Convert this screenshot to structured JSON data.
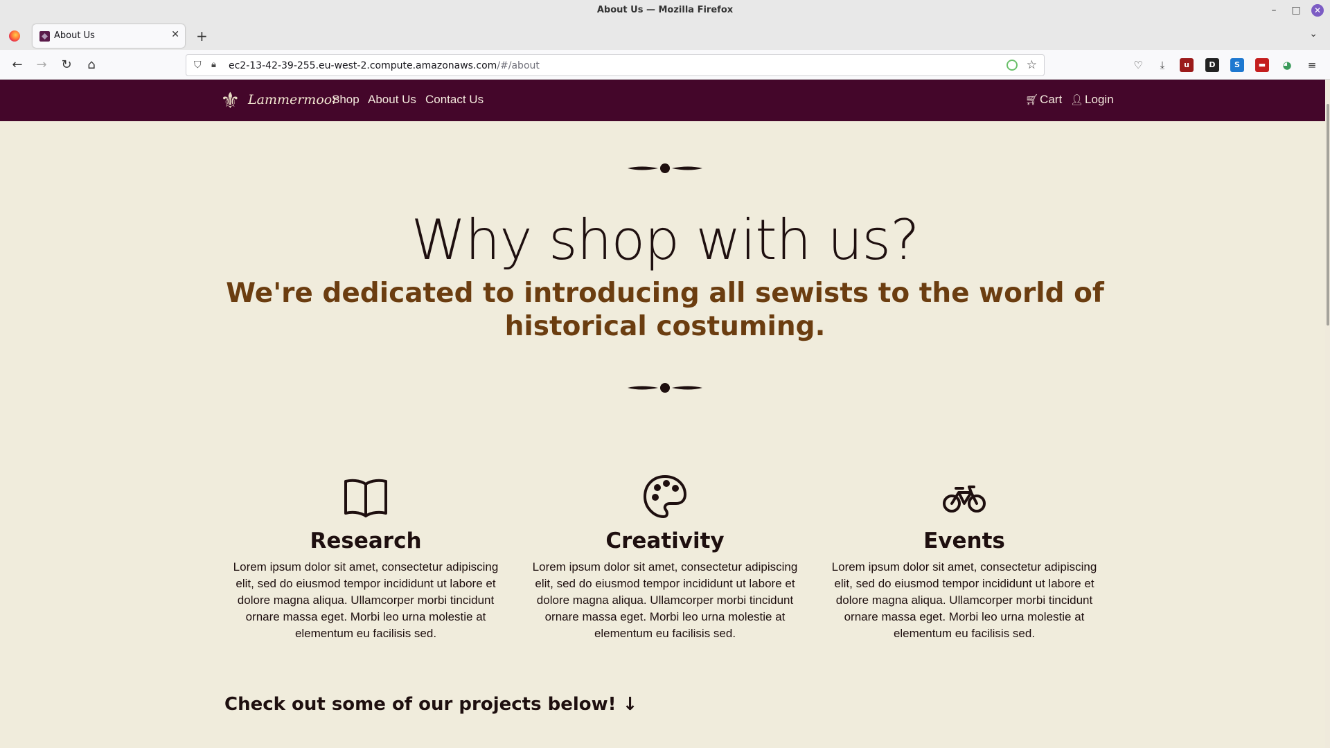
{
  "window": {
    "title": "About Us — Mozilla Firefox"
  },
  "tabs": [
    {
      "label": "About Us",
      "active": true
    }
  ],
  "address_bar": {
    "url_host": "ec2-13-42-39-255.eu-west-2.compute.amazonaws.com",
    "url_path": "/#/about"
  },
  "site_nav": {
    "brand": "Lammermoor",
    "links": [
      "Shop",
      "About Us",
      "Contact Us"
    ],
    "cart_label": "Cart",
    "login_label": "Login",
    "background_color": "#44062a"
  },
  "hero": {
    "title": "Why shop with us?",
    "subtitle": "We're dedicated to introducing all sewists to the world of historical costuming."
  },
  "features": [
    {
      "icon": "book-icon",
      "title": "Research",
      "text": "Lorem ipsum dolor sit amet, consectetur adipiscing elit, sed do eiusmod tempor incididunt ut labore et dolore magna aliqua. Ullamcorper morbi tincidunt ornare massa eget. Morbi leo urna molestie at elementum eu facilisis sed."
    },
    {
      "icon": "palette-icon",
      "title": "Creativity",
      "text": "Lorem ipsum dolor sit amet, consectetur adipiscing elit, sed do eiusmod tempor incididunt ut labore et dolore magna aliqua. Ullamcorper morbi tincidunt ornare massa eget. Morbi leo urna molestie at elementum eu facilisis sed."
    },
    {
      "icon": "bicycle-icon",
      "title": "Events",
      "text": "Lorem ipsum dolor sit amet, consectetur adipiscing elit, sed do eiusmod tempor incididunt ut labore et dolore magna aliqua. Ullamcorper morbi tincidunt ornare massa eget. Morbi leo urna molestie at elementum eu facilisis sed."
    }
  ],
  "projects_cta": "Check out some of our projects below! ↓",
  "colors": {
    "page_background": "#f0ecdc",
    "subtitle": "#6b3d10",
    "text": "#1e0f0f"
  }
}
